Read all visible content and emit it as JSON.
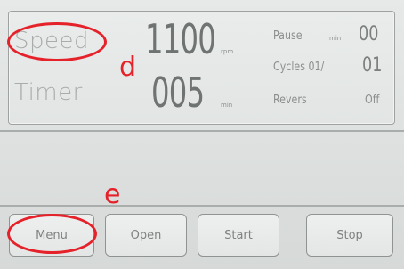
{
  "display": {
    "speed_label": "Speed",
    "speed_value": "1100",
    "speed_unit": "rpm",
    "timer_label": "Timer",
    "timer_value": "005",
    "timer_unit": "min",
    "pause_label": "Pause",
    "pause_unit": "min",
    "pause_value": "00",
    "cycles_label": "Cycles 01/",
    "cycles_value": "01",
    "revers_label": "Revers",
    "revers_value": "Off"
  },
  "buttons": {
    "menu": "Menu",
    "open": "Open",
    "start": "Start",
    "stop": "Stop"
  },
  "annotations": {
    "d": "d",
    "e": "e"
  },
  "colors": {
    "annotation": "#e5222a"
  }
}
